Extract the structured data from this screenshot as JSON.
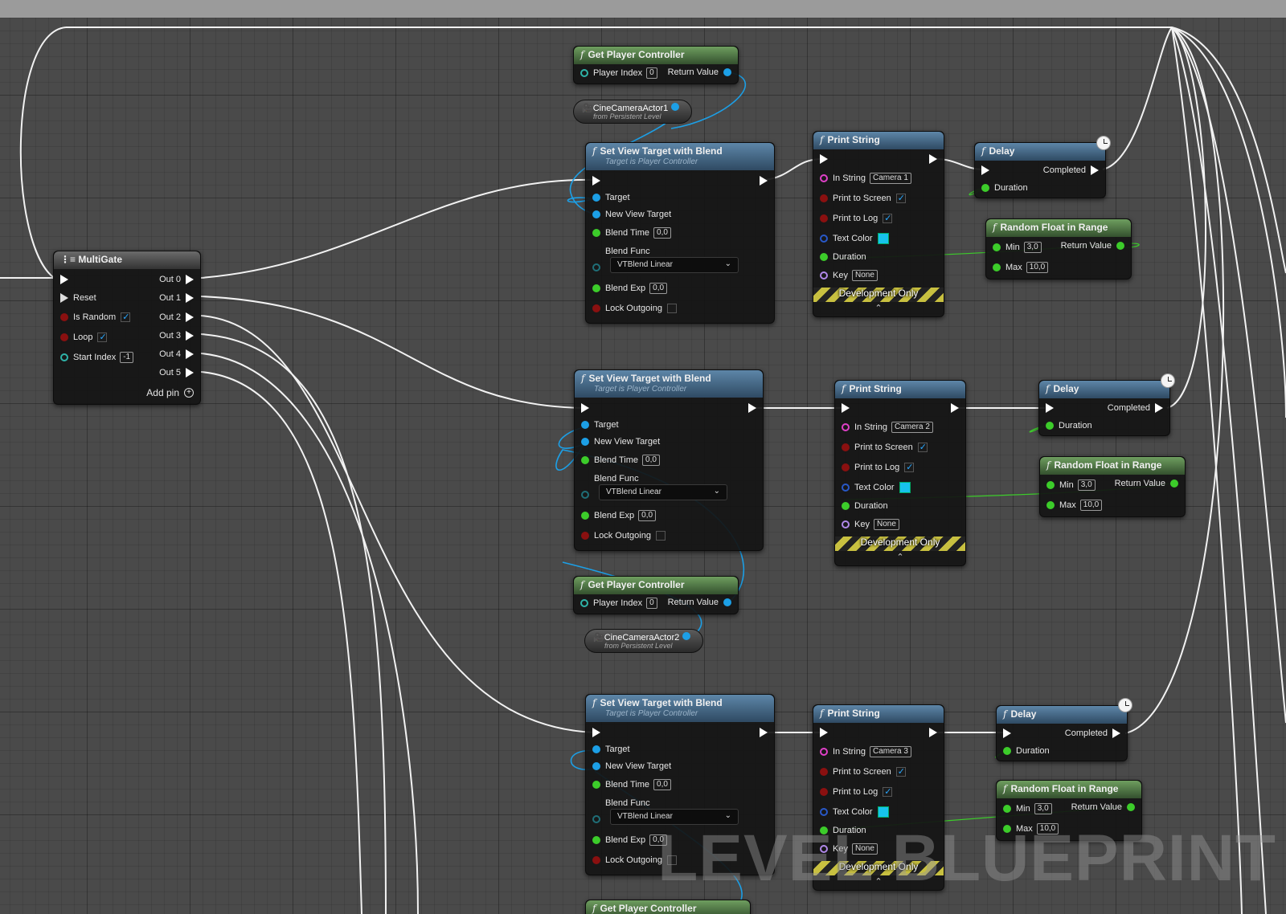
{
  "watermark": "LEVEL BLUEPRINT",
  "colors": {
    "exec_wire": "#ffffff",
    "object_pin": "#1c9fe6",
    "float_pin": "#3ccc2a",
    "string_pin": "#e040c8",
    "bool_pin": "#8a1010",
    "text_color_swatch": "#17c3ec",
    "function_header": "#2f4a63",
    "pure_function_header": "#34502e"
  },
  "multigate": {
    "title": "MultiGate",
    "icon": "multigate-icon",
    "inputs": {
      "reset": "Reset",
      "is_random": "Is Random",
      "is_random_checked": true,
      "loop": "Loop",
      "loop_checked": true,
      "start_index": "Start Index",
      "start_index_value": "-1"
    },
    "outputs": [
      "Out 0",
      "Out 1",
      "Out 2",
      "Out 3",
      "Out 4",
      "Out 5"
    ],
    "add_pin": "Add pin"
  },
  "get_player_controller": [
    {
      "title": "Get Player Controller",
      "player_index_label": "Player Index",
      "player_index_value": "0",
      "return_label": "Return Value"
    },
    {
      "title": "Get Player Controller",
      "player_index_label": "Player Index",
      "player_index_value": "0",
      "return_label": "Return Value"
    },
    {
      "title": "Get Player Controller"
    }
  ],
  "camera_refs": [
    {
      "name": "CineCameraActor1",
      "sub": "from Persistent Level",
      "icon": "camera-actor-icon"
    },
    {
      "name": "CineCameraActor2",
      "sub": "from Persistent Level",
      "icon": "camera-actor-icon"
    }
  ],
  "set_view_target": [
    {
      "title": "Set View Target with Blend",
      "subtitle": "Target is Player Controller",
      "target": "Target",
      "new_view_target": "New View Target",
      "blend_time": "Blend Time",
      "blend_time_value": "0,0",
      "blend_func": "Blend Func",
      "blend_func_value": "VTBlend Linear",
      "blend_exp": "Blend Exp",
      "blend_exp_value": "0,0",
      "lock_outgoing": "Lock Outgoing",
      "lock_outgoing_checked": false
    },
    {
      "title": "Set View Target with Blend",
      "subtitle": "Target is Player Controller",
      "target": "Target",
      "new_view_target": "New View Target",
      "blend_time": "Blend Time",
      "blend_time_value": "0,0",
      "blend_func": "Blend Func",
      "blend_func_value": "VTBlend Linear",
      "blend_exp": "Blend Exp",
      "blend_exp_value": "0,0",
      "lock_outgoing": "Lock Outgoing",
      "lock_outgoing_checked": false
    },
    {
      "title": "Set View Target with Blend",
      "subtitle": "Target is Player Controller",
      "target": "Target",
      "new_view_target": "New View Target",
      "blend_time": "Blend Time",
      "blend_time_value": "0,0",
      "blend_func": "Blend Func",
      "blend_func_value": "VTBlend Linear",
      "blend_exp": "Blend Exp",
      "blend_exp_value": "0,0",
      "lock_outgoing": "Lock Outgoing",
      "lock_outgoing_checked": false
    }
  ],
  "print_string": [
    {
      "title": "Print String",
      "in_string": "In String",
      "in_string_value": "Camera 1",
      "print_to_screen": "Print to Screen",
      "print_to_screen_checked": true,
      "print_to_log": "Print to Log",
      "print_to_log_checked": true,
      "text_color": "Text Color",
      "duration": "Duration",
      "key": "Key",
      "key_value": "None",
      "dev_only": "Development Only"
    },
    {
      "title": "Print String",
      "in_string": "In String",
      "in_string_value": "Camera 2",
      "print_to_screen": "Print to Screen",
      "print_to_screen_checked": true,
      "print_to_log": "Print to Log",
      "print_to_log_checked": true,
      "text_color": "Text Color",
      "duration": "Duration",
      "key": "Key",
      "key_value": "None",
      "dev_only": "Development Only"
    },
    {
      "title": "Print String",
      "in_string": "In String",
      "in_string_value": "Camera 3",
      "print_to_screen": "Print to Screen",
      "print_to_screen_checked": true,
      "print_to_log": "Print to Log",
      "print_to_log_checked": true,
      "text_color": "Text Color",
      "duration": "Duration",
      "key": "Key",
      "key_value": "None",
      "dev_only": "Development Only"
    }
  ],
  "delay": [
    {
      "title": "Delay",
      "completed": "Completed",
      "duration": "Duration"
    },
    {
      "title": "Delay",
      "completed": "Completed",
      "duration": "Duration"
    },
    {
      "title": "Delay",
      "completed": "Completed",
      "duration": "Duration"
    }
  ],
  "random_float": [
    {
      "title": "Random Float in Range",
      "min": "Min",
      "min_value": "3,0",
      "max": "Max",
      "max_value": "10,0",
      "return_label": "Return Value"
    },
    {
      "title": "Random Float in Range",
      "min": "Min",
      "min_value": "3,0",
      "max": "Max",
      "max_value": "10,0",
      "return_label": "Return Value"
    },
    {
      "title": "Random Float in Range",
      "min": "Min",
      "min_value": "3,0",
      "max": "Max",
      "max_value": "10,0",
      "return_label": "Return Value"
    }
  ]
}
